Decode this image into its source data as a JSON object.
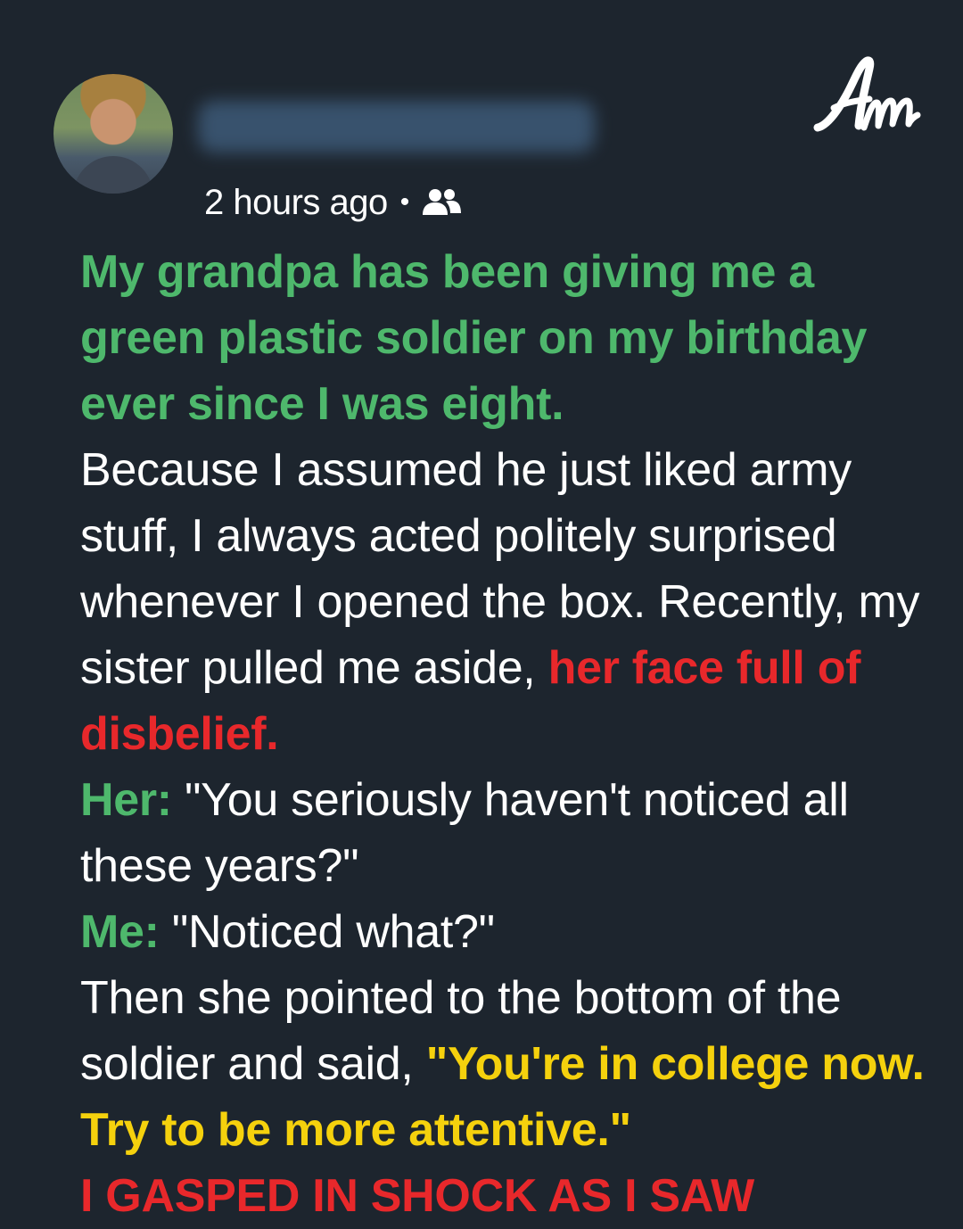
{
  "header": {
    "timestamp": "2 hours ago",
    "separator": "•",
    "audience_icon": "friends-icon",
    "avatar_icon": "user-avatar",
    "logo_text": "Am"
  },
  "colors": {
    "background": "#1d252e",
    "green": "#4eb86c",
    "red": "#e8282b",
    "yellow": "#f5d10d",
    "text": "#ffffff"
  },
  "story": {
    "headline": "My grandpa has been giving me a green plastic soldier on my birthday ever since I was eight.",
    "para1": "Because I assumed he just liked army stuff, I always acted politely surprised whenever I opened the box. Recently, my sister pulled me aside, ",
    "para1_highlight": "her face full of disbelief.",
    "her_label": "Her:",
    "her_line": " \"You seriously haven't noticed all these years?\"",
    "me_label": "Me:",
    "me_line": " \"Noticed what?\"",
    "para2": "Then she pointed to the bottom of the soldier and said, ",
    "para2_highlight": "\"You're in college now. Try to be more attentive.\"",
    "cliffhanger": "I GASPED IN SHOCK AS I SAW"
  }
}
